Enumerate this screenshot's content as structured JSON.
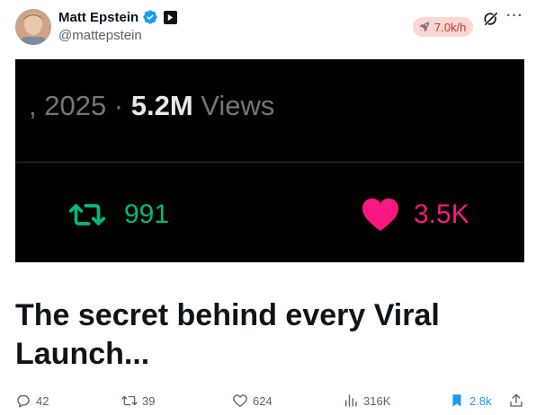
{
  "author": {
    "display_name": "Matt Epstein",
    "handle": "@mattepstein"
  },
  "growth_badge": {
    "icon": "rocket-icon",
    "label": "7.0k/h"
  },
  "media": {
    "date_prefix": ", 2025 · ",
    "views_count": "5.2M",
    "views_label": " Views",
    "retweet_count": "991",
    "like_count": "3.5K"
  },
  "tweet": {
    "text": "The secret behind every Viral Launch..."
  },
  "actions": {
    "replies": "42",
    "retweets": "39",
    "likes": "624",
    "views": "316K",
    "bookmarks": "2.8k"
  },
  "colors": {
    "verified_blue": "#1d9bf0",
    "retweet_green": "#00ba7c",
    "like_pink": "#f91880",
    "growth_red": "#c0392b"
  }
}
